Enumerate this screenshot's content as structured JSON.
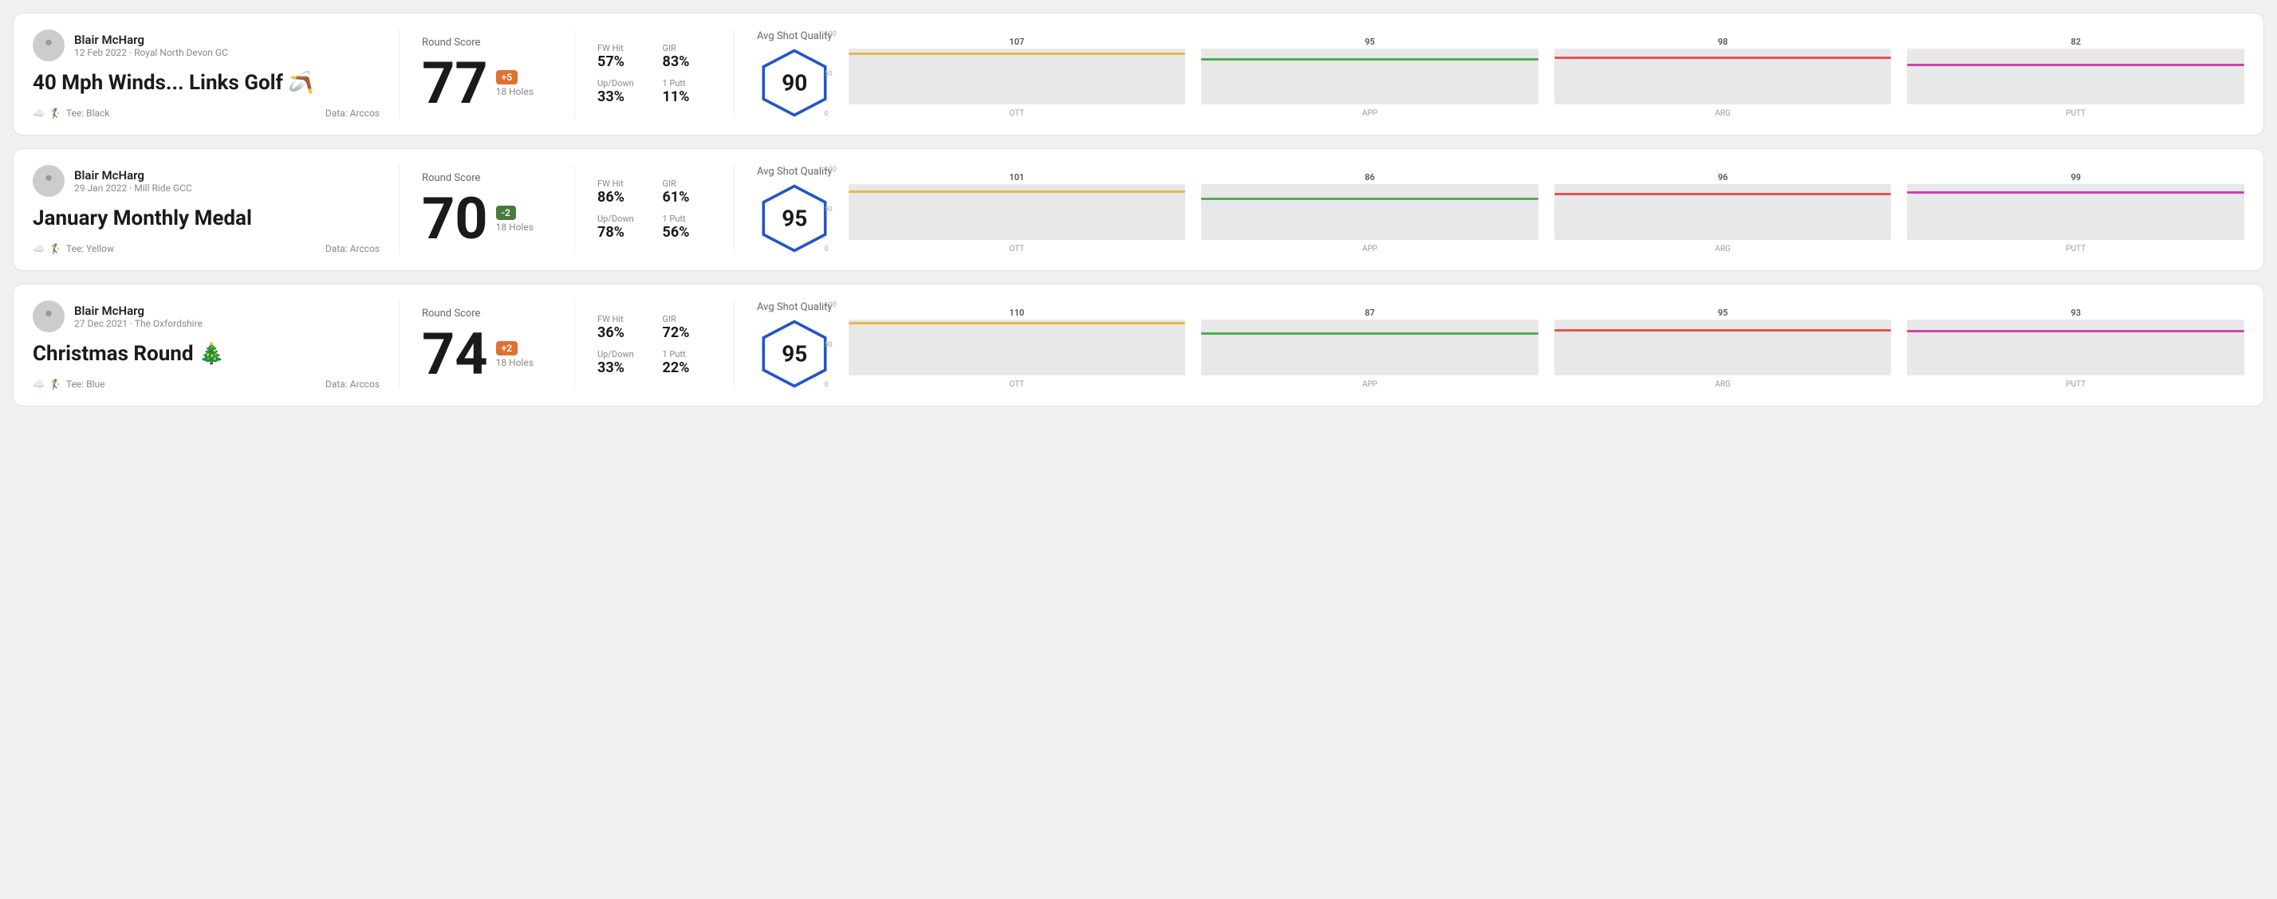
{
  "rounds": [
    {
      "id": "round1",
      "user": {
        "name": "Blair McHarg",
        "date": "12 Feb 2022 · Royal North Devon GC"
      },
      "title": "40 Mph Winds... Links Golf 🪃",
      "tee": "Black",
      "data_source": "Data: Arccos",
      "score": "77",
      "score_diff": "+5",
      "score_diff_type": "positive",
      "holes": "18 Holes",
      "fw_hit": "57%",
      "gir": "83%",
      "up_down": "33%",
      "one_putt": "11%",
      "avg_shot_quality": "90",
      "chart": {
        "label": "Avg Shot Quality",
        "bars": [
          {
            "label": "OTT",
            "value": 107,
            "color": "#e8b84b"
          },
          {
            "label": "APP",
            "value": 95,
            "color": "#4caf50"
          },
          {
            "label": "ARG",
            "value": 98,
            "color": "#e05555"
          },
          {
            "label": "PUTT",
            "value": 82,
            "color": "#cc44aa"
          }
        ],
        "max": 120
      }
    },
    {
      "id": "round2",
      "user": {
        "name": "Blair McHarg",
        "date": "29 Jan 2022 · Mill Ride GCC"
      },
      "title": "January Monthly Medal",
      "tee": "Yellow",
      "data_source": "Data: Arccos",
      "score": "70",
      "score_diff": "-2",
      "score_diff_type": "negative",
      "holes": "18 Holes",
      "fw_hit": "86%",
      "gir": "61%",
      "up_down": "78%",
      "one_putt": "56%",
      "avg_shot_quality": "95",
      "chart": {
        "label": "Avg Shot Quality",
        "bars": [
          {
            "label": "OTT",
            "value": 101,
            "color": "#e8b84b"
          },
          {
            "label": "APP",
            "value": 86,
            "color": "#4caf50"
          },
          {
            "label": "ARG",
            "value": 96,
            "color": "#e05555"
          },
          {
            "label": "PUTT",
            "value": 99,
            "color": "#cc44aa"
          }
        ],
        "max": 120
      }
    },
    {
      "id": "round3",
      "user": {
        "name": "Blair McHarg",
        "date": "27 Dec 2021 · The Oxfordshire"
      },
      "title": "Christmas Round 🎄",
      "tee": "Blue",
      "data_source": "Data: Arccos",
      "score": "74",
      "score_diff": "+2",
      "score_diff_type": "positive",
      "holes": "18 Holes",
      "fw_hit": "36%",
      "gir": "72%",
      "up_down": "33%",
      "one_putt": "22%",
      "avg_shot_quality": "95",
      "chart": {
        "label": "Avg Shot Quality",
        "bars": [
          {
            "label": "OTT",
            "value": 110,
            "color": "#e8b84b"
          },
          {
            "label": "APP",
            "value": 87,
            "color": "#4caf50"
          },
          {
            "label": "ARG",
            "value": 95,
            "color": "#e05555"
          },
          {
            "label": "PUTT",
            "value": 93,
            "color": "#cc44aa"
          }
        ],
        "max": 120
      }
    }
  ],
  "labels": {
    "round_score": "Round Score",
    "fw_hit": "FW Hit",
    "gir": "GIR",
    "up_down": "Up/Down",
    "one_putt": "1 Putt",
    "avg_shot_quality": "Avg Shot Quality",
    "data_arccos": "Data: Arccos",
    "tee_prefix": "Tee:",
    "ott": "OTT",
    "app": "APP",
    "arg": "ARG",
    "putt": "PUTT",
    "y_100": "100",
    "y_50": "50",
    "y_0": "0"
  }
}
